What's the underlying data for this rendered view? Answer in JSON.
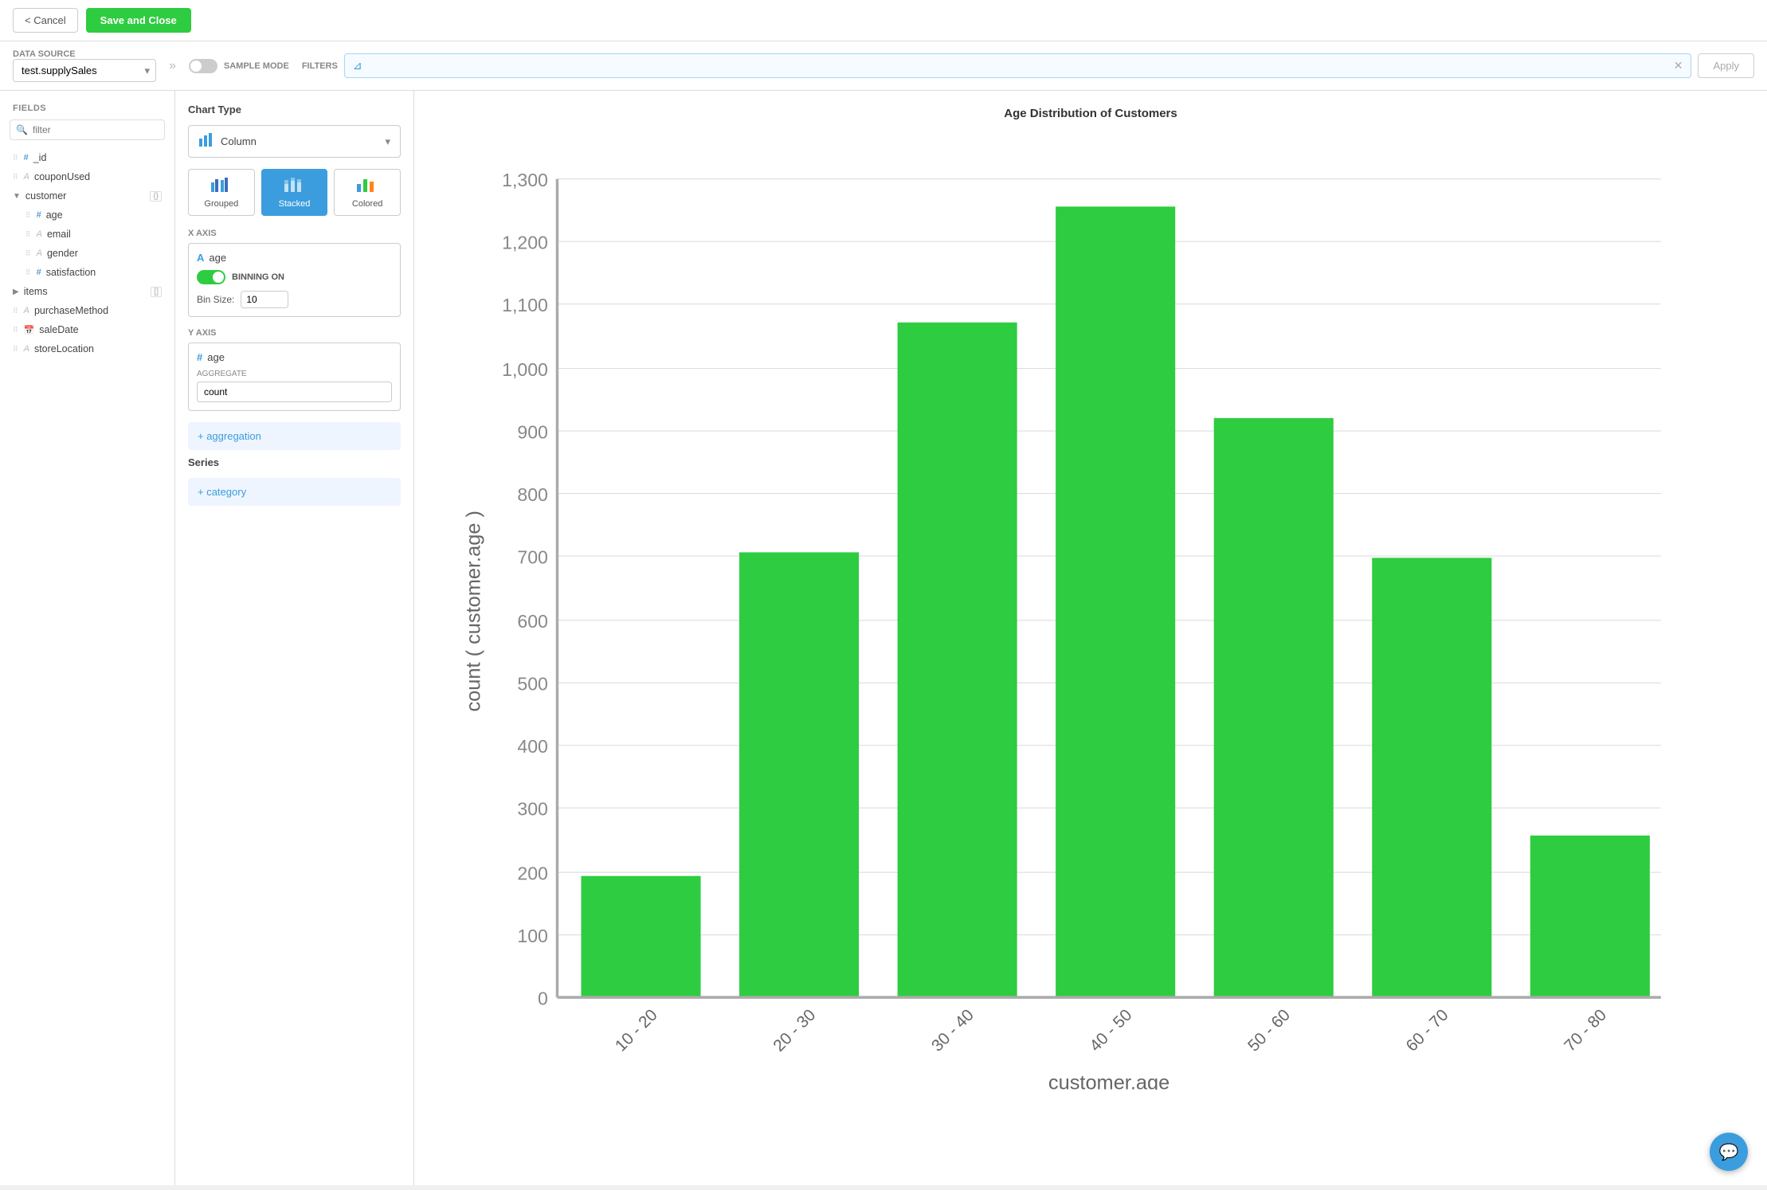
{
  "topbar": {
    "cancel_label": "< Cancel",
    "save_label": "Save and Close"
  },
  "configbar": {
    "datasource_label": "Data Source",
    "sample_mode_label": "Sample Mode",
    "filters_label": "Filters",
    "datasource_value": "test.supplySales",
    "apply_label": "Apply"
  },
  "sidebar": {
    "heading": "FIELDS",
    "search_placeholder": "filter",
    "fields": [
      {
        "name": "_id",
        "type": "hash"
      },
      {
        "name": "couponUsed",
        "type": "str"
      },
      {
        "name": "customer",
        "type": "group",
        "badge": "{}",
        "expanded": true,
        "children": [
          {
            "name": "age",
            "type": "hash"
          },
          {
            "name": "email",
            "type": "str"
          },
          {
            "name": "gender",
            "type": "str"
          },
          {
            "name": "satisfaction",
            "type": "hash"
          }
        ]
      },
      {
        "name": "items",
        "type": "group",
        "badge": "[]",
        "expanded": false
      },
      {
        "name": "purchaseMethod",
        "type": "str"
      },
      {
        "name": "saleDate",
        "type": "date"
      },
      {
        "name": "storeLocation",
        "type": "str"
      }
    ]
  },
  "chart_config": {
    "chart_type_label": "Chart Type",
    "chart_type_value": "Column",
    "subtypes": [
      {
        "id": "grouped",
        "label": "Grouped",
        "active": false
      },
      {
        "id": "stacked",
        "label": "Stacked",
        "active": true
      },
      {
        "id": "colored",
        "label": "Colored",
        "active": false
      }
    ],
    "x_axis_label": "X Axis",
    "x_field": "age",
    "binning_label": "BINNING ON",
    "bin_size_label": "Bin Size:",
    "bin_size_value": "10",
    "y_axis_label": "Y Axis",
    "y_field": "age",
    "aggregate_label": "AGGREGATE",
    "aggregate_value": "count",
    "add_aggregation_label": "+ aggregation",
    "series_label": "Series",
    "add_category_label": "+ category"
  },
  "chart": {
    "title": "Age Distribution of Customers",
    "x_axis_label": "customer.age",
    "y_axis_label": "count ( customer.age )",
    "bars": [
      {
        "label": "10 - 20",
        "value": 190
      },
      {
        "label": "20 - 30",
        "value": 700
      },
      {
        "label": "30 - 40",
        "value": 1060
      },
      {
        "label": "40 - 50",
        "value": 1240
      },
      {
        "label": "50 - 60",
        "value": 910
      },
      {
        "label": "60 - 70",
        "value": 690
      },
      {
        "label": "70 - 80",
        "value": 255
      }
    ],
    "y_max": 1300,
    "y_ticks": [
      0,
      100,
      200,
      300,
      400,
      500,
      600,
      700,
      800,
      900,
      1000,
      1100,
      1200,
      1300
    ]
  }
}
